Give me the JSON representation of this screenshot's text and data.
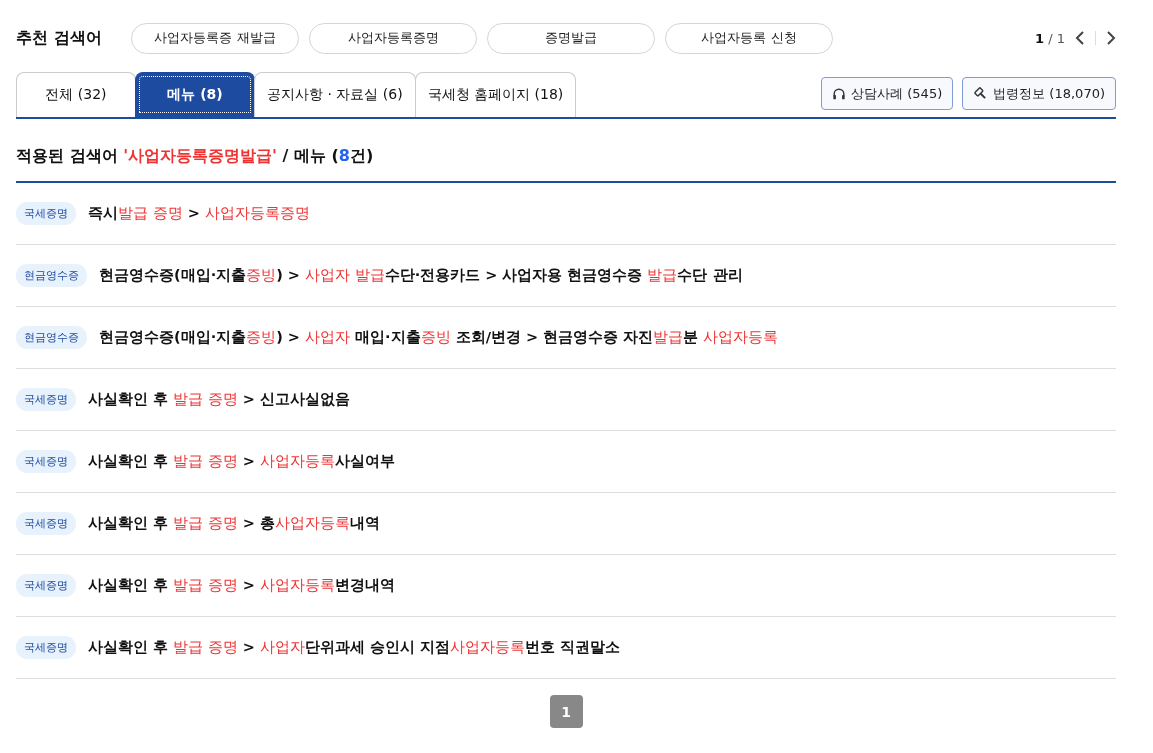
{
  "recommend": {
    "label": "추천 검색어",
    "keywords": [
      "사업자등록증 재발급",
      "사업자등록증명",
      "증명발급",
      "사업자등록 신청"
    ],
    "page": "1",
    "separator": "/",
    "total": "1"
  },
  "tabs": [
    {
      "label": "전체 (32)",
      "selected": false
    },
    {
      "label": "메뉴 (8)",
      "selected": true
    },
    {
      "label": "공지사항 · 자료실 (6)",
      "selected": false
    },
    {
      "label": "국세청 홈페이지 (18)",
      "selected": false
    }
  ],
  "side_buttons": [
    {
      "kind": "headset",
      "label": "상담사례 (545)"
    },
    {
      "kind": "gavel",
      "label": "법령정보 (18,070)"
    }
  ],
  "heading": {
    "prefix": "적용된 검색어 ",
    "query": "'사업자등록증명발급'",
    "middle": " / 메뉴 (",
    "count": "8",
    "suffix": "건)"
  },
  "results": [
    {
      "category": "국세증명",
      "segments": [
        {
          "text": "즉시",
          "hit": false
        },
        {
          "text": "발급 증명",
          "hit": true
        },
        {
          "text": " > ",
          "hit": false
        },
        {
          "text": "사업자등록증명",
          "hit": true
        }
      ]
    },
    {
      "category": "현금영수증",
      "segments": [
        {
          "text": "현금영수증(매입·지출",
          "hit": false
        },
        {
          "text": "증빙",
          "hit": true
        },
        {
          "text": ") > ",
          "hit": false
        },
        {
          "text": "사업자 발급",
          "hit": true
        },
        {
          "text": "수단·전용카드 > 사업자용 현금영수증 ",
          "hit": false
        },
        {
          "text": "발급",
          "hit": true
        },
        {
          "text": "수단 관리",
          "hit": false
        }
      ]
    },
    {
      "category": "현금영수증",
      "segments": [
        {
          "text": "현금영수증(매입·지출",
          "hit": false
        },
        {
          "text": "증빙",
          "hit": true
        },
        {
          "text": ") > ",
          "hit": false
        },
        {
          "text": "사업자",
          "hit": true
        },
        {
          "text": " 매입·지출",
          "hit": false
        },
        {
          "text": "증빙",
          "hit": true
        },
        {
          "text": " 조회/변경 > 현금영수증 자진",
          "hit": false
        },
        {
          "text": "발급",
          "hit": true
        },
        {
          "text": "분 ",
          "hit": false
        },
        {
          "text": "사업자등록",
          "hit": true
        }
      ]
    },
    {
      "category": "국세증명",
      "segments": [
        {
          "text": "사실확인 후 ",
          "hit": false
        },
        {
          "text": "발급 증명",
          "hit": true
        },
        {
          "text": " > 신고사실없음",
          "hit": false
        }
      ]
    },
    {
      "category": "국세증명",
      "segments": [
        {
          "text": "사실확인 후 ",
          "hit": false
        },
        {
          "text": "발급 증명",
          "hit": true
        },
        {
          "text": " > ",
          "hit": false
        },
        {
          "text": "사업자등록",
          "hit": true
        },
        {
          "text": "사실여부",
          "hit": false
        }
      ]
    },
    {
      "category": "국세증명",
      "segments": [
        {
          "text": "사실확인 후 ",
          "hit": false
        },
        {
          "text": "발급 증명",
          "hit": true
        },
        {
          "text": " > 총",
          "hit": false
        },
        {
          "text": "사업자등록",
          "hit": true
        },
        {
          "text": "내역",
          "hit": false
        }
      ]
    },
    {
      "category": "국세증명",
      "segments": [
        {
          "text": "사실확인 후 ",
          "hit": false
        },
        {
          "text": "발급 증명",
          "hit": true
        },
        {
          "text": " > ",
          "hit": false
        },
        {
          "text": "사업자등록",
          "hit": true
        },
        {
          "text": "변경내역",
          "hit": false
        }
      ]
    },
    {
      "category": "국세증명",
      "segments": [
        {
          "text": "사실확인 후 ",
          "hit": false
        },
        {
          "text": "발급 증명",
          "hit": true
        },
        {
          "text": " > ",
          "hit": false
        },
        {
          "text": "사업자",
          "hit": true
        },
        {
          "text": "단위과세 승인시 지점",
          "hit": false
        },
        {
          "text": "사업자등록",
          "hit": true
        },
        {
          "text": "번호 직권말소",
          "hit": false
        }
      ]
    }
  ],
  "pagination": [
    {
      "label": "1",
      "selected": true
    }
  ]
}
